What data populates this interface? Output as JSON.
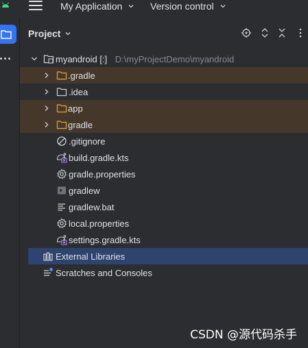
{
  "topbar": {
    "app_menu_label": "My Application",
    "vcs_menu_label": "Version control"
  },
  "panel": {
    "title": "Project"
  },
  "tree": {
    "root": {
      "name": "myandroid",
      "module_marker": "[:]",
      "path": "D:\\myProjectDemo\\myandroid"
    },
    "items": [
      {
        "label": ".gradle",
        "icon": "folder-icon"
      },
      {
        "label": ".idea",
        "icon": "folder-icon"
      },
      {
        "label": "app",
        "icon": "folder-icon"
      },
      {
        "label": "gradle",
        "icon": "folder-icon"
      },
      {
        "label": ".gitignore",
        "icon": "ignore-file-icon"
      },
      {
        "label": "build.gradle.kts",
        "icon": "gradle-kts-icon"
      },
      {
        "label": "gradle.properties",
        "icon": "gear-icon"
      },
      {
        "label": "gradlew",
        "icon": "terminal-icon"
      },
      {
        "label": "gradlew.bat",
        "icon": "text-file-icon"
      },
      {
        "label": "local.properties",
        "icon": "gear-icon"
      },
      {
        "label": "settings.gradle.kts",
        "icon": "gradle-kts-icon"
      }
    ],
    "external_libraries": "External Libraries",
    "scratches": "Scratches and Consoles"
  },
  "watermark": "CSDN @源代码杀手",
  "colors": {
    "background": "#2b2d30",
    "excluded_row": "#45382b",
    "selected_row": "#2e436e",
    "accent": "#3574f0",
    "folder": "#e8a33d"
  }
}
